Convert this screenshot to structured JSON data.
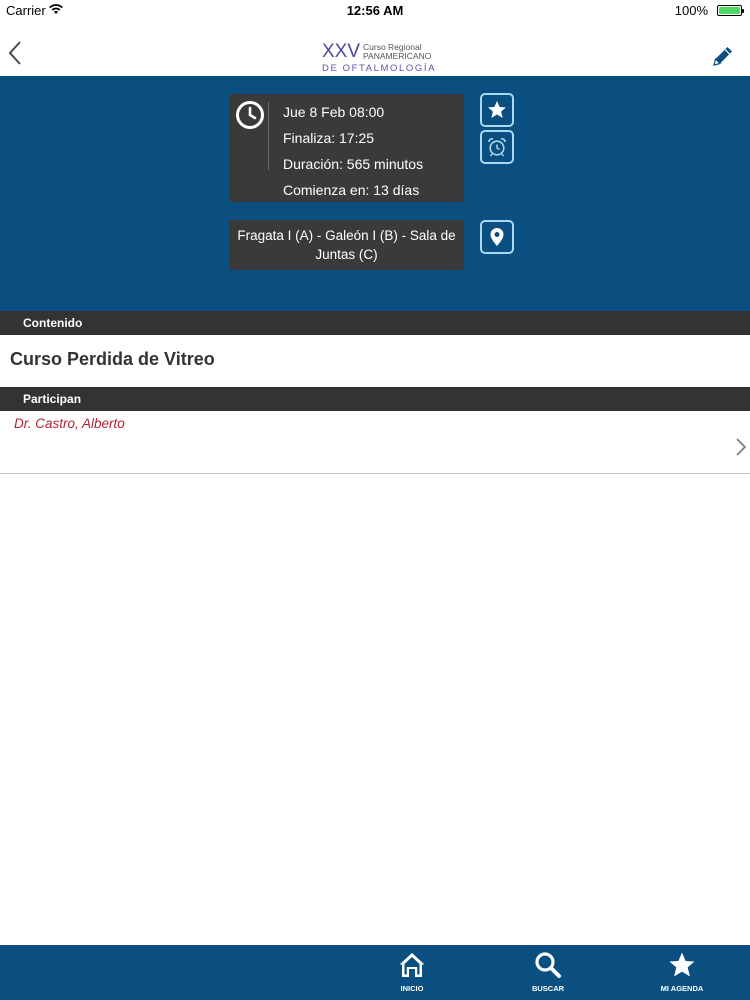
{
  "status_bar": {
    "carrier": "Carrier",
    "time": "12:56 AM",
    "battery": "100%",
    "battery_color": "#4cd964"
  },
  "nav": {
    "logo_numeral": "XXV",
    "logo_line1": "Curso Regional",
    "logo_line2": "PANAMERICANO",
    "logo_line3": "DE OFTALMOLOGÍA",
    "back_icon": "chevron-left-icon",
    "edit_icon": "pencil-icon"
  },
  "event": {
    "date": "Jue 8  Feb  08:00",
    "ends": "Finaliza: 17:25",
    "duration": "Duración: 565 minutos",
    "starts_in": "Comienza en: 13 días",
    "location": "Fragata I (A) - Galeón I (B) - Sala de Juntas (C)",
    "header_color": "#0a4f80"
  },
  "sections": {
    "contenido": "Contenido",
    "participan": "Participan"
  },
  "course_title": "Curso Perdida de Vitreo",
  "participants": [
    {
      "name": "Dr. Castro, Alberto"
    }
  ],
  "tabs": [
    {
      "label": "INICIO",
      "icon": "home-icon"
    },
    {
      "label": "BUSCAR",
      "icon": "search-icon"
    },
    {
      "label": "MI AGENDA",
      "icon": "star-icon"
    }
  ]
}
